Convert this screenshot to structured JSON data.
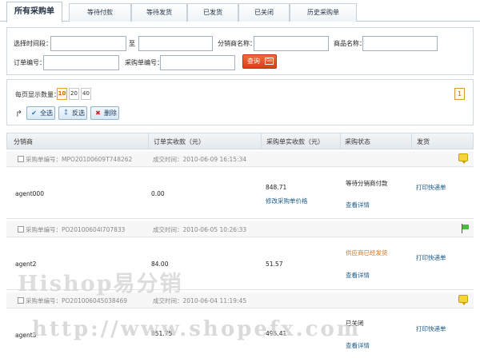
{
  "tabs": [
    {
      "label": "所有采购单"
    },
    {
      "label": "等待付款"
    },
    {
      "label": "等待发货"
    },
    {
      "label": "已发货"
    },
    {
      "label": "已关闭"
    },
    {
      "label": "历史采购单"
    }
  ],
  "filter": {
    "time_range_label": "选择时间段：",
    "to_label": "至",
    "distributor_label": "分销商名称：",
    "product_label": "商品名称：",
    "order_no_label": "订单编号：",
    "purchase_no_label": "采购单编号：",
    "start_value": "",
    "end_value": "",
    "distributor_value": "",
    "product_value": "",
    "order_no_value": "",
    "purchase_no_value": "",
    "search_button": "查询"
  },
  "toolbar": {
    "per_page_label": "每页显示数量：",
    "per_page_options": [
      "10",
      "20",
      "40"
    ],
    "current_page": "1",
    "select_all": "全选",
    "invert": "反选",
    "delete": "删除"
  },
  "table": {
    "headers": [
      "分销商",
      "订单实收款（元）",
      "采购单实收款（元）",
      "采购状态",
      "发货"
    ],
    "groups": [
      {
        "purchase_no": "采购单编号：MPO20100609T748262",
        "trade_time": "成交时间：2010-06-09 16:15:34",
        "distributor": "agent000",
        "order_amount": "0.00",
        "purchase_amount": "848.71",
        "modify_price": "修改采购单价格",
        "status": "等待分销商付款",
        "detail": "查看详情",
        "ship": "打印快递单",
        "icon": "note"
      },
      {
        "purchase_no": "采购单编号：PO20100604I707833",
        "trade_time": "成交时间：2010-06-05 10:26:33",
        "distributor": "agent2",
        "order_amount": "84.00",
        "purchase_amount": "51.57",
        "status": "供应商已经发货",
        "detail": "查看详情",
        "ship": "打印快递单",
        "icon": "flag"
      },
      {
        "purchase_no": "采购单编号：PO201006045038469",
        "trade_time": "成交时间：2010-06-04 11:19:45",
        "distributor": "agent3",
        "order_amount": "851.75",
        "purchase_amount": "495.41",
        "status": "已关闭",
        "detail": "查看详情",
        "ship": "打印快递单",
        "icon": "note"
      }
    ]
  },
  "watermark": {
    "line1": "Hishop易分销",
    "line2": "http://www.shopefx.com"
  },
  "colors": {
    "accent_orange": "#d8401b",
    "link_blue": "#1a5a8c",
    "status_orange": "#d8701c",
    "border": "#cfd9e2"
  }
}
